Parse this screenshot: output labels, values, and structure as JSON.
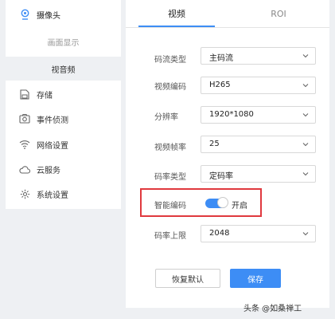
{
  "sidebar": {
    "camera": "摄像头",
    "display": "画面显示",
    "audio_video": "视音频",
    "storage": "存储",
    "event_detect": "事件侦测",
    "network": "网络设置",
    "cloud": "云服务",
    "system": "系统设置"
  },
  "tabs": {
    "video": "视频",
    "roi": "ROI"
  },
  "form": {
    "stream_type": {
      "label": "码流类型",
      "value": "主码流"
    },
    "video_codec": {
      "label": "视频编码",
      "value": "H265"
    },
    "resolution": {
      "label": "分辨率",
      "value": "1920*1080"
    },
    "frame_rate": {
      "label": "视频帧率",
      "value": "25"
    },
    "bitrate_type": {
      "label": "码率类型",
      "value": "定码率"
    },
    "smart_codec": {
      "label": "智能编码",
      "state": "开启"
    },
    "bitrate_limit": {
      "label": "码率上限",
      "value": "2048"
    }
  },
  "buttons": {
    "reset": "恢复默认",
    "save": "保存"
  },
  "watermark": "头条 @如桑禅工",
  "colors": {
    "accent": "#3d8df5",
    "highlight": "#e0393e"
  }
}
